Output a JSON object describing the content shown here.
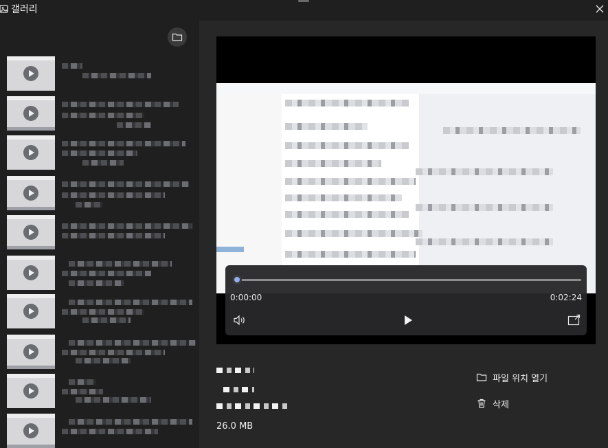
{
  "window": {
    "title": "갤러리",
    "app_icon": "gallery-app-icon",
    "close_icon": "close-icon"
  },
  "sidebar": {
    "open_folder_icon": "folder-icon",
    "items_count_visible": 10
  },
  "player": {
    "current_time": "0:00:00",
    "duration": "0:02:24",
    "progress": 0.0,
    "volume_icon": "volume-icon",
    "play_icon": "play-icon",
    "pip_icon": "pop-out-icon"
  },
  "details": {
    "file_size": "26.0 MB",
    "open_location_label": "파일 위치 열기",
    "open_location_icon": "folder-icon",
    "delete_label": "삭제",
    "delete_icon": "trash-icon"
  },
  "colors": {
    "background": "#1f1f1f",
    "main_panel": "#272727",
    "accent": "#8fb2ee"
  }
}
